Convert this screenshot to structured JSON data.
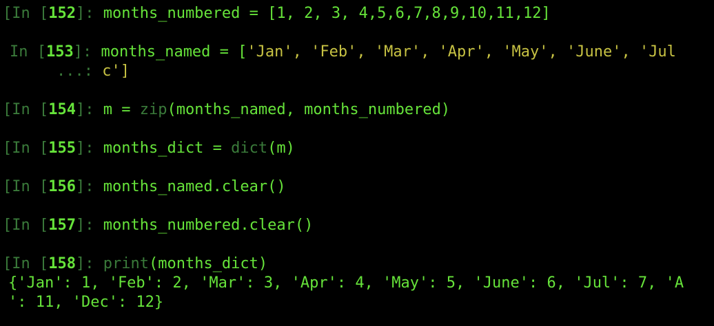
{
  "terminal": {
    "cells": [
      {
        "prompt_label": "[In [",
        "prompt_number": "152",
        "prompt_close": "]: ",
        "code": "months_numbered = [1, 2, 3, 4,5,6,7,8,9,10,11,12]"
      },
      {
        "prompt_label": "In [",
        "prompt_number": "153",
        "prompt_close": "]: ",
        "code_prefix": "months_named = [",
        "code_strings": "'Jan', 'Feb', 'Mar', 'Apr', 'May', 'June', 'Jul",
        "continuation_prompt": "...: ",
        "continuation_code": "c']"
      },
      {
        "prompt_label": "[In [",
        "prompt_number": "154",
        "prompt_close": "]: ",
        "code_prefix": "m = ",
        "code_builtin": "zip",
        "code_rest": "(months_named, months_numbered)"
      },
      {
        "prompt_label": "[In [",
        "prompt_number": "155",
        "prompt_close": "]: ",
        "code_prefix": "months_dict = ",
        "code_builtin": "dict",
        "code_rest": "(m)"
      },
      {
        "prompt_label": "[In [",
        "prompt_number": "156",
        "prompt_close": "]: ",
        "code": "months_named.clear()"
      },
      {
        "prompt_label": "[In [",
        "prompt_number": "157",
        "prompt_close": "]: ",
        "code": "months_numbered.clear()"
      },
      {
        "prompt_label": "[In [",
        "prompt_number": "158",
        "prompt_close": "]: ",
        "code_builtin": "print",
        "code_rest": "(months_dict)"
      }
    ],
    "output_line_1": "{'Jan': 1, 'Feb': 2, 'Mar': 3, 'Apr': 4, 'May': 5, 'June': 6, 'Jul': 7, 'A",
    "output_line_2": "': 11, 'Dec': 12}"
  },
  "colors": {
    "background": "#000000",
    "prompt_dim": "#3a7a3a",
    "code_green": "#66e33a",
    "string_yellow": "#c7c243"
  }
}
